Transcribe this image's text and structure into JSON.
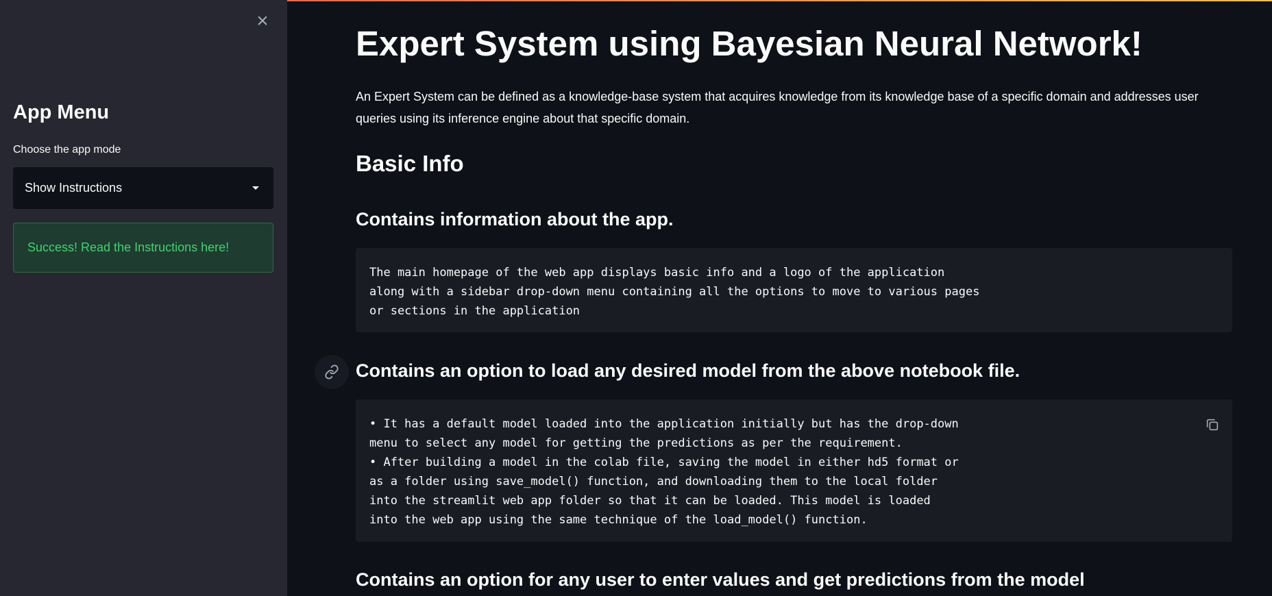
{
  "sidebar": {
    "close_icon": "close-icon",
    "title": "App Menu",
    "mode_label": "Choose the app mode",
    "mode_selected": "Show Instructions",
    "success_message": "Success! Read the Instructions here!"
  },
  "main": {
    "title": "Expert System using Bayesian Neural Network!",
    "intro": "An Expert System can be defined as a knowledge-base system that acquires knowledge from its knowledge base of a specific domain and addresses user queries using its inference engine about that specific domain.",
    "basic_info_heading": "Basic Info",
    "section1": {
      "heading": "Contains information about the app.",
      "code_lines": [
        "The main homepage of the web app displays basic info and a logo of the application",
        "along with a sidebar drop-down menu containing all the options to move to various pages",
        "or sections in the application"
      ]
    },
    "section2": {
      "heading": "Contains an option to load any desired model from the above notebook file.",
      "code_lines": [
        "• It has a default model loaded into the application initially but has the drop-down",
        "menu to select any model for getting the predictions as per the requirement.",
        "• After building a model in the colab file, saving the model in either hd5 format or",
        "as a folder using save_model() function, and downloading them to the local folder",
        "into the streamlit web app folder so that it can be loaded. This model is loaded",
        "into the web app using the same technique of the load_model() function."
      ]
    },
    "section3": {
      "heading": "Contains an option for any user to enter values and get predictions from the model"
    }
  },
  "colors": {
    "background": "#0e1117",
    "sidebar": "#262730",
    "code_block": "#1a1c24",
    "success_text": "#3dd56d",
    "success_bg": "#1f3c30"
  }
}
